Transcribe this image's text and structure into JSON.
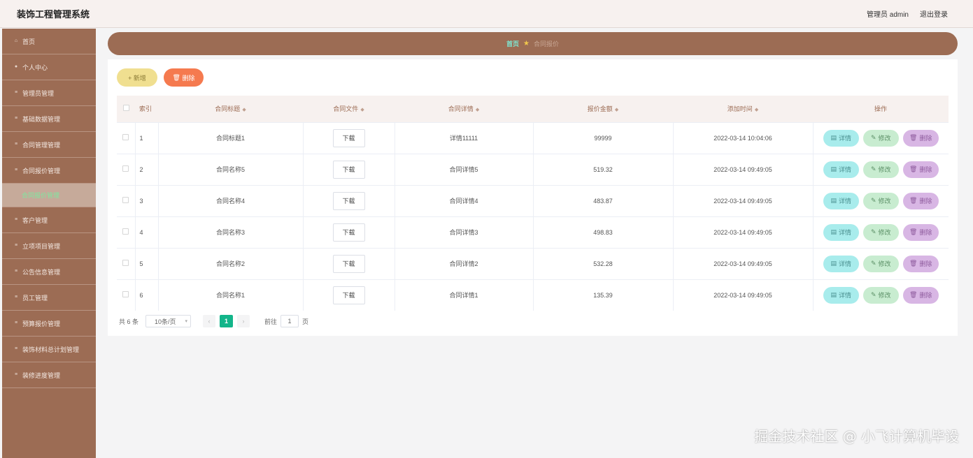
{
  "header": {
    "app_title": "装饰工程管理系统",
    "user_label": "管理员 admin",
    "logout_label": "退出登录"
  },
  "sidebar": {
    "items": [
      {
        "label": "首页",
        "icon": "home-icon"
      },
      {
        "label": "个人中心",
        "icon": "user-icon"
      },
      {
        "label": "管理员管理",
        "icon": "menu-icon"
      },
      {
        "label": "基础数据管理",
        "icon": "menu-icon"
      },
      {
        "label": "合同管理管理",
        "icon": "menu-icon"
      },
      {
        "label": "合同报价管理",
        "icon": "menu-icon"
      },
      {
        "label": "合同报价管理",
        "icon": "",
        "sub": true
      },
      {
        "label": "客户管理",
        "icon": "menu-icon"
      },
      {
        "label": "立项项目管理",
        "icon": "menu-icon"
      },
      {
        "label": "公告信息管理",
        "icon": "menu-icon"
      },
      {
        "label": "员工管理",
        "icon": "menu-icon"
      },
      {
        "label": "预算报价管理",
        "icon": "menu-icon"
      },
      {
        "label": "装饰材料总计划管理",
        "icon": "menu-icon"
      },
      {
        "label": "装修进度管理",
        "icon": "menu-icon"
      }
    ]
  },
  "breadcrumb": {
    "home": "首页",
    "current": "合同报价"
  },
  "toolbar": {
    "add_label": "+ 新增",
    "delete_label": "删除"
  },
  "table": {
    "headers": {
      "index": "索引",
      "title": "合同标题",
      "file": "合同文件",
      "detail": "合同详情",
      "amount": "报价金额",
      "time": "添加时间",
      "ops": "操作"
    },
    "download_label": "下载",
    "op_labels": {
      "detail": "详情",
      "edit": "修改",
      "delete": "删除"
    },
    "rows": [
      {
        "index": "1",
        "title": "合同标题1",
        "detail": "详情11111",
        "amount": "99999",
        "time": "2022-03-14 10:04:06"
      },
      {
        "index": "2",
        "title": "合同名称5",
        "detail": "合同详情5",
        "amount": "519.32",
        "time": "2022-03-14 09:49:05"
      },
      {
        "index": "3",
        "title": "合同名称4",
        "detail": "合同详情4",
        "amount": "483.87",
        "time": "2022-03-14 09:49:05"
      },
      {
        "index": "4",
        "title": "合同名称3",
        "detail": "合同详情3",
        "amount": "498.83",
        "time": "2022-03-14 09:49:05"
      },
      {
        "index": "5",
        "title": "合同名称2",
        "detail": "合同详情2",
        "amount": "532.28",
        "time": "2022-03-14 09:49:05"
      },
      {
        "index": "6",
        "title": "合同名称1",
        "detail": "合同详情1",
        "amount": "135.39",
        "time": "2022-03-14 09:49:05"
      }
    ]
  },
  "pagination": {
    "total_label": "共 6 条",
    "page_size": "10条/页",
    "current_page": "1",
    "goto_label": "前往",
    "goto_value": "1",
    "page_suffix": "页"
  },
  "watermark": "掘金技术社区 @ 小飞计算机毕设",
  "colors": {
    "sidebar": "#9c6c54",
    "accent": "#13b58a",
    "add": "#f0df90",
    "delete": "#f57a4f"
  }
}
